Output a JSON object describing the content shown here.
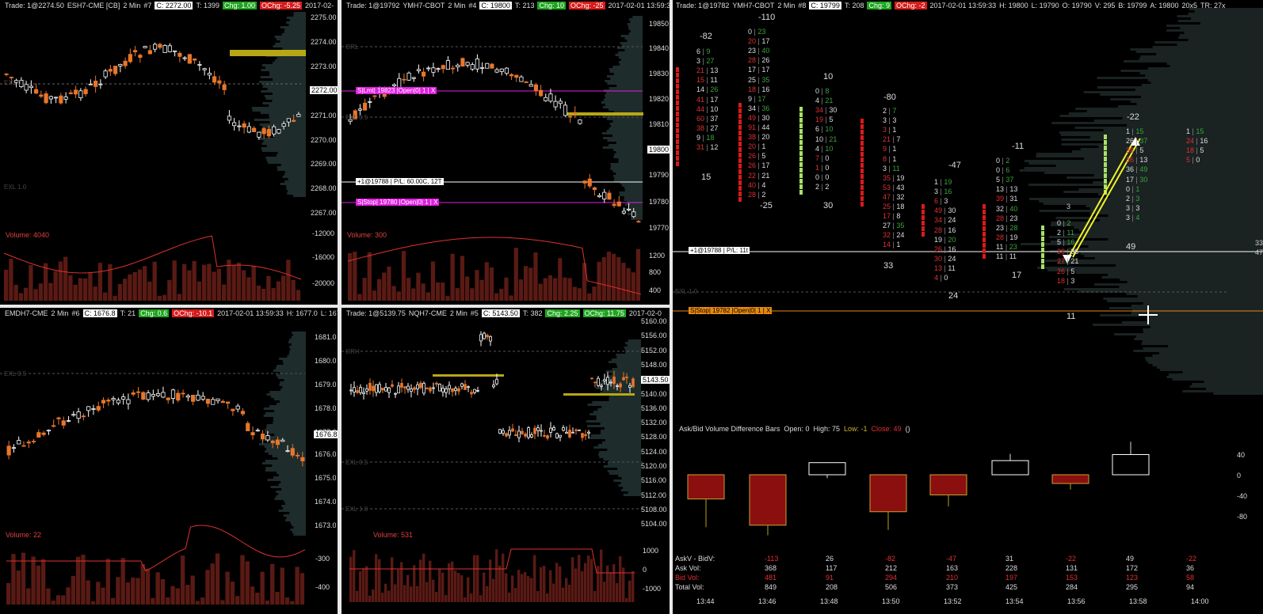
{
  "es": {
    "header": [
      "Trade: 1@2274.50",
      "ESH7-CME [CB]",
      "2 Min",
      "#7",
      "C: 2272.00",
      "T: 1399",
      "Chg: 1.00",
      "OChg: -5.25",
      "2017-02-"
    ],
    "axis": [
      "2275.00",
      "2274.00",
      "2273.00",
      "2272.00",
      "2271.00",
      "2270.00",
      "2269.00",
      "2268.00",
      "2267.00"
    ],
    "price_tag": "2272.00",
    "ext1": "EXL 0.5",
    "ext2": "EXL 1.0",
    "volume_label": "Volume: 4040",
    "vol_axis": [
      "-12000",
      "-16000",
      "-20000"
    ]
  },
  "ym_small": {
    "header": [
      "Trade: 1@19792",
      "YMH7-CBOT",
      "2 Min",
      "#4",
      "C: 19800",
      "T: 213",
      "Chg: 10",
      "OChg: -25",
      "2017-02-01 13:59:3"
    ],
    "axis": [
      "19850",
      "19840",
      "19830",
      "19820",
      "19810",
      "19800",
      "19790",
      "19780",
      "19770"
    ],
    "price_tag": "19800",
    "orl": "ORL",
    "exl": "EXL 0.5",
    "order_limit": "S|Lmt| 19823 |Open|0| 1 | X",
    "order_pos": "+1@19788 | P/L: 60.00C, 12T",
    "order_stop": "S|Stop| 19780 |Open|0| 1 | X",
    "volume_label": "Volume: 300",
    "vol_axis": [
      "1200",
      "800",
      "400"
    ]
  },
  "emd": {
    "header": [
      "EMDH7-CME",
      "2 Min",
      "#6",
      "C: 1676.8",
      "T: 21",
      "Chg: 0.6",
      "OChg: -10.1",
      "2017-02-01 13:59:33",
      "H: 1677.0",
      "L: 1676"
    ],
    "axis": [
      "1681.0",
      "1680.0",
      "1679.0",
      "1678.0",
      "1677.0",
      "1676.0",
      "1675.0",
      "1674.0",
      "1673.0"
    ],
    "price_tag": "1676.8",
    "exl": "EXL 0.5",
    "volume_label": "Volume: 22",
    "vol_axis": [
      "-300",
      "-400"
    ]
  },
  "nq": {
    "header": [
      "Trade: 1@5139.75",
      "NQH7-CME",
      "2 Min",
      "#5",
      "C: 5143.50",
      "T: 382",
      "Chg: 2.25",
      "OChg: 11.75",
      "2017-02-0"
    ],
    "axis": [
      "5160.00",
      "5156.00",
      "5152.00",
      "5148.00",
      "5144.00",
      "5140.00",
      "5136.00",
      "5132.00",
      "5128.00",
      "5124.00",
      "5120.00",
      "5116.00",
      "5112.00",
      "5108.00",
      "5104.00"
    ],
    "price_tag": "5143.50",
    "orh": "ORH",
    "exl1": "EXL 0.5",
    "exl2": "EXL 1.0",
    "volume_label": "Volume: 531",
    "vol_axis": [
      "1000",
      "0",
      "-1000"
    ]
  },
  "footprint": {
    "header": [
      "Trade: 1@19782",
      "YMH7-CBOT",
      "2 Min",
      "#8",
      "C: 19799",
      "T: 208",
      "Chg: 9",
      "OChg: -2",
      "2017-02-01 13:59:33",
      "H: 19800",
      "L: 19790",
      "O: 19790",
      "V: 295",
      "B: 19799",
      "A: 19800",
      "20x5",
      "TR: 27x"
    ],
    "order_pos": "+1@19788 | P/L: 11t",
    "order_stop": "S|Stop| 19782 |Open|0| 1 | X",
    "exl": "EXL 1.0",
    "deltas_top": [
      "-82",
      "-110",
      "10",
      "-80",
      "-47",
      "-11",
      "-22"
    ],
    "deltas_bottom": [
      "15",
      "-25",
      "30",
      "33",
      "24",
      "17",
      "11",
      "49"
    ],
    "col1": [
      [
        "6",
        "9"
      ],
      [
        "3",
        "27"
      ],
      [
        "21",
        "13"
      ],
      [
        "15",
        "11"
      ],
      [
        "14",
        "26"
      ],
      [
        "41",
        "17"
      ],
      [
        "44",
        "10"
      ],
      [
        "60",
        "37"
      ],
      [
        "38",
        "27"
      ],
      [
        "9",
        "18"
      ],
      [
        "31",
        "12"
      ]
    ],
    "col2": [
      [
        "0",
        "23"
      ],
      [
        "20",
        "17"
      ],
      [
        "23",
        "40"
      ],
      [
        "28",
        "26"
      ],
      [
        "17",
        "17"
      ],
      [
        "25",
        "35"
      ],
      [
        "18",
        "16"
      ],
      [
        "9",
        "17"
      ],
      [
        "34",
        "36"
      ],
      [
        "49",
        "30"
      ],
      [
        "91",
        "44"
      ],
      [
        "38",
        "20"
      ],
      [
        "20",
        "1"
      ],
      [
        "26",
        "5"
      ],
      [
        "26",
        "17"
      ],
      [
        "22",
        "21"
      ],
      [
        "40",
        "4"
      ],
      [
        "28",
        "2"
      ]
    ],
    "col3": [
      [
        "0",
        "8"
      ],
      [
        "4",
        "21"
      ],
      [
        "34",
        "30"
      ],
      [
        "19",
        "5"
      ],
      [
        "6",
        "10"
      ],
      [
        "10",
        "21"
      ],
      [
        "4",
        "10"
      ],
      [
        "7",
        "0"
      ],
      [
        "1",
        "0"
      ],
      [
        "0",
        "0"
      ],
      [
        "2",
        "2"
      ]
    ],
    "col4": [
      [
        "2",
        "7"
      ],
      [
        "3",
        "3"
      ],
      [
        "3",
        "1"
      ],
      [
        "21",
        "7"
      ],
      [
        "9",
        "1"
      ],
      [
        "8",
        "1"
      ],
      [
        "3",
        "11"
      ],
      [
        "35",
        "19"
      ],
      [
        "53",
        "43"
      ],
      [
        "47",
        "32"
      ],
      [
        "25",
        "18"
      ],
      [
        "17",
        "8"
      ],
      [
        "27",
        "35"
      ],
      [
        "32",
        "24"
      ],
      [
        "14",
        "1"
      ]
    ],
    "col5": [
      [
        "1",
        "19"
      ],
      [
        "3",
        "16"
      ],
      [
        "6",
        "3"
      ],
      [
        "49",
        "30"
      ],
      [
        "34",
        "24"
      ],
      [
        "28",
        "16"
      ],
      [
        "19",
        "20"
      ],
      [
        "26",
        "16"
      ],
      [
        "30",
        "24"
      ],
      [
        "13",
        "11"
      ],
      [
        "4",
        "0"
      ]
    ],
    "col6": [
      [
        "0",
        "2"
      ],
      [
        "0",
        "6"
      ],
      [
        "5",
        "37"
      ],
      [
        "13",
        "13"
      ],
      [
        "39",
        "31"
      ],
      [
        "32",
        "40"
      ],
      [
        "28",
        "23"
      ],
      [
        "23",
        "28"
      ],
      [
        "28",
        "19"
      ],
      [
        "11",
        "23"
      ],
      [
        "11",
        "11"
      ]
    ],
    "col7": [
      [
        "0",
        "2"
      ],
      [
        "2",
        "11"
      ],
      [
        "5",
        "16"
      ],
      [
        "39",
        "36"
      ],
      [
        "27",
        "21"
      ],
      [
        "26",
        "5"
      ],
      [
        "18",
        "3"
      ]
    ],
    "col7_top": "3",
    "col8": [
      [
        "1",
        "15"
      ],
      [
        "26",
        "37"
      ],
      [
        "38",
        "5"
      ],
      [
        "36",
        "13"
      ],
      [
        "36",
        "49"
      ],
      [
        "17",
        "30"
      ],
      [
        "0",
        "1"
      ],
      [
        "2",
        "3"
      ],
      [
        "3",
        "3"
      ],
      [
        "3",
        "4"
      ]
    ],
    "col9": [
      [
        "1",
        "15"
      ],
      [
        "24",
        "16"
      ],
      [
        "18",
        "5"
      ],
      [
        "5",
        "0"
      ]
    ],
    "side_right": [
      "33",
      "47"
    ]
  },
  "diff_bars": {
    "title": "Ask/Bid Volume Difference Bars",
    "open_label": "Open: 0",
    "high_label": "High: 75",
    "low_label": "Low: -1",
    "close_label": "Close: 49",
    "paren": "()",
    "axis": [
      "40",
      "0",
      "-40",
      "-80"
    ],
    "row_labels": [
      "AskV - BidV:",
      "Ask Vol:",
      "Bid Vol:",
      "Total Vol:"
    ],
    "times": [
      "13:44",
      "13:46",
      "13:48",
      "13:50",
      "13:52",
      "13:54",
      "13:56",
      "13:58",
      "14:00"
    ],
    "askv_bidv": [
      "-113",
      "26",
      "-82",
      "-47",
      "31",
      "-22",
      "49",
      "-22"
    ],
    "ask_vol": [
      "368",
      "117",
      "212",
      "163",
      "228",
      "131",
      "172",
      "36"
    ],
    "bid_vol": [
      "481",
      "91",
      "294",
      "210",
      "197",
      "153",
      "123",
      "58"
    ],
    "total_vol": [
      "849",
      "208",
      "506",
      "373",
      "425",
      "284",
      "295",
      "94"
    ],
    "bars": [
      {
        "open": 0,
        "close": -36,
        "high": 0,
        "low": -78
      },
      {
        "open": 0,
        "close": -75,
        "high": 0,
        "low": -90
      },
      {
        "open": 0,
        "close": 18,
        "high": 18,
        "low": -5
      },
      {
        "open": 0,
        "close": -55,
        "high": 0,
        "low": -82
      },
      {
        "open": 0,
        "close": -30,
        "high": 0,
        "low": -47
      },
      {
        "open": 0,
        "close": 21,
        "high": 31,
        "low": 0
      },
      {
        "open": 0,
        "close": -13,
        "high": 0,
        "low": -22
      },
      {
        "open": 0,
        "close": 30,
        "high": 49,
        "low": 0
      }
    ]
  },
  "colors": {
    "up": "#ffffff",
    "down": "#e8762a",
    "bid": "#e03030",
    "ask": "#3aa53a",
    "yellow": "#f2f22a",
    "magenta": "#e020e0",
    "orange": "#e88a10",
    "volume": "#e03030",
    "volbar": "#5a1a14"
  }
}
